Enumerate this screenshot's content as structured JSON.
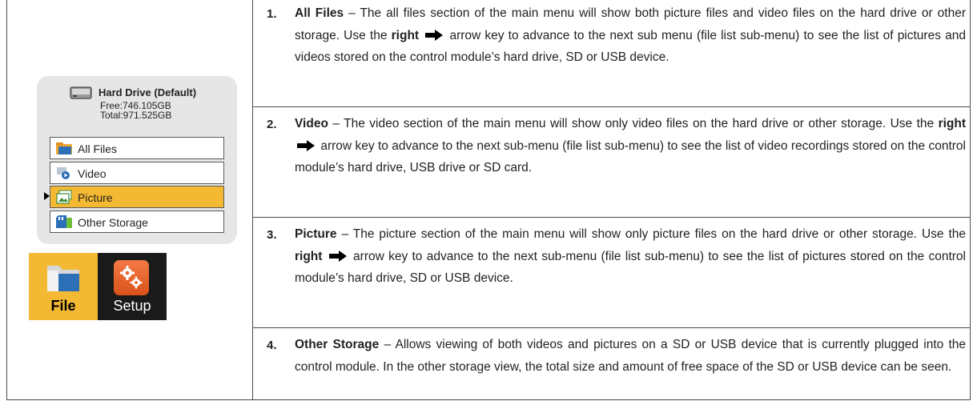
{
  "illustration": {
    "drive_name": "Hard Drive (Default)",
    "free": "Free:746.105GB",
    "total": "Total:971.525GB",
    "menu_items": [
      "All Files",
      "Video",
      "Picture",
      "Other Storage"
    ],
    "selected_item": "Picture",
    "tabs": {
      "file": "File",
      "setup": "Setup"
    },
    "colors": {
      "selected": "#f4b932",
      "panel": "#e6e6e6",
      "setup_icon": "#e8632b"
    }
  },
  "entries": [
    {
      "number": "1.",
      "title": "All Files",
      "a": "– The all files section of the main menu will show both picture files and video files on the hard drive or other storage. Use the ",
      "kw": "right",
      "b": "arrow key to advance to the next sub menu (file list sub-menu) to see the list of pictures and videos stored on the control module’s hard drive, SD or USB device."
    },
    {
      "number": "2.",
      "title": "Video",
      "a": "– The video section of the main menu will show only video files on the hard drive or other storage. Use the ",
      "kw": "right",
      "b": "arrow key to advance to the next sub-menu (file list sub-menu) to see the list of video recordings stored on the control module’s hard drive, USB drive or SD card."
    },
    {
      "number": "3.",
      "title": "Picture",
      "a": "– The picture section of the main menu will show only picture files on the hard drive or other storage. Use the ",
      "kw": "right",
      "b": "arrow key to advance to the next sub-menu (file list sub-menu) to see the list of pictures stored on the control module’s hard drive, SD or USB device."
    },
    {
      "number": "4.",
      "title": "Other Storage",
      "a": "– Allows viewing of both videos and pictures on a SD or USB device that is currently plugged into the control module. In the other storage view, the total size and amount of free space of the SD or USB device can be seen."
    }
  ]
}
